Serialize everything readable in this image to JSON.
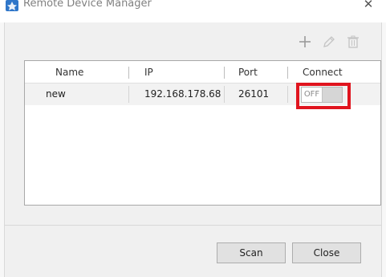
{
  "window": {
    "title": "Remote Device Manager",
    "close_glyph": "✕"
  },
  "toolbar": {
    "add_icon": "plus-icon",
    "edit_icon": "pencil-icon",
    "delete_icon": "trash-icon"
  },
  "table": {
    "columns": [
      "Name",
      "IP",
      "Port",
      "Connect"
    ],
    "rows": [
      {
        "name": "new",
        "ip": "192.168.178.68",
        "port": "26101",
        "connect": "OFF"
      }
    ]
  },
  "buttons": {
    "scan": "Scan",
    "close": "Close"
  },
  "colors": {
    "highlight": "#e0141e",
    "app_icon": "#2f76c9"
  }
}
